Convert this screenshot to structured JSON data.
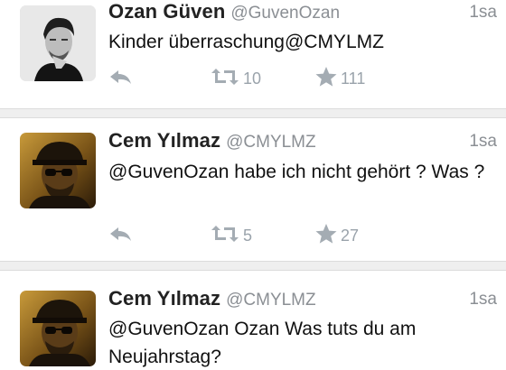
{
  "tweets": [
    {
      "name": "Ozan Güven",
      "handle": "@GuvenOzan",
      "time": "1sa",
      "text": "Kinder überraschung@CMYLMZ",
      "retweets": "10",
      "favorites": "111"
    },
    {
      "name": "Cem Yılmaz",
      "handle": "@CMYLMZ",
      "time": "1sa",
      "text": "@GuvenOzan habe ich nicht gehört ? Was ?",
      "retweets": "5",
      "favorites": "27"
    },
    {
      "name": "Cem Yılmaz",
      "handle": "@CMYLMZ",
      "time": "1sa",
      "text": "@GuvenOzan Ozan Was tuts du am Neujahrstag?"
    }
  ],
  "icons": {
    "reply": "reply-icon",
    "retweet": "retweet-icon",
    "favorite": "star-icon"
  },
  "colors": {
    "name": "#222222",
    "meta": "#8b8f94",
    "action": "#a4acb3",
    "divider": "#efefef"
  }
}
